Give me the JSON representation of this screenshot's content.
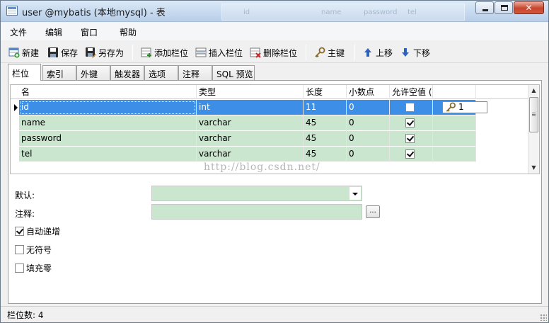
{
  "window": {
    "title": "user @mybatis (本地mysql) - 表",
    "ghost_title": [
      "id",
      "name",
      "password",
      "tel"
    ]
  },
  "menu": [
    "文件",
    "编辑",
    "窗口",
    "帮助"
  ],
  "toolbar": {
    "new": "新建",
    "save": "保存",
    "save_as": "另存为",
    "add_field": "添加栏位",
    "insert_field": "插入栏位",
    "delete_field": "删除栏位",
    "primary_key": "主键",
    "move_up": "上移",
    "move_down": "下移"
  },
  "tabs": [
    "栏位",
    "索引",
    "外键",
    "触发器",
    "选项",
    "注释",
    "SQL 预览"
  ],
  "grid": {
    "headers": [
      "名",
      "类型",
      "长度",
      "小数点",
      "允许空值 ("
    ],
    "rows": [
      {
        "name": "id",
        "type": "int",
        "length": "11",
        "decimals": "0",
        "nullable": false,
        "key": "1"
      },
      {
        "name": "name",
        "type": "varchar",
        "length": "45",
        "decimals": "0",
        "nullable": true
      },
      {
        "name": "password",
        "type": "varchar",
        "length": "45",
        "decimals": "0",
        "nullable": true
      },
      {
        "name": "tel",
        "type": "varchar",
        "length": "45",
        "decimals": "0",
        "nullable": true
      }
    ]
  },
  "watermark": "http://blog.csdn.net/",
  "properties": {
    "default_label": "默认:",
    "comment_label": "注释:",
    "ellipsis": "...",
    "options": [
      {
        "label": "自动递增",
        "checked": true
      },
      {
        "label": "无符号",
        "checked": false
      },
      {
        "label": "填充零",
        "checked": false
      }
    ]
  },
  "status": {
    "field_count": "栏位数: 4"
  },
  "colors": {
    "row_green": "#cbe6cf",
    "row_selected": "#3d8ee6"
  }
}
